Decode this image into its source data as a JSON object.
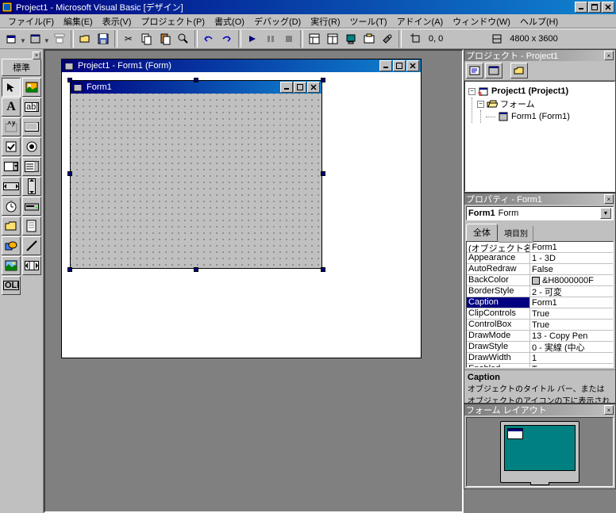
{
  "app": {
    "title": "Project1 - Microsoft Visual Basic [デザイン]"
  },
  "menu": {
    "file": "ファイル(F)",
    "edit": "編集(E)",
    "view": "表示(V)",
    "project": "プロジェクト(P)",
    "format": "書式(O)",
    "debug": "デバッグ(D)",
    "run": "実行(R)",
    "tools": "ツール(T)",
    "addins": "アドイン(A)",
    "window": "ウィンドウ(W)",
    "help": "ヘルプ(H)"
  },
  "toolbar": {
    "coords": "0, 0",
    "size": "4800 x 3600"
  },
  "toolbox": {
    "title": "標準"
  },
  "designer": {
    "title": "Project1 - Form1 (Form)",
    "form_title": "Form1"
  },
  "project_panel": {
    "title": "プロジェクト - Project1",
    "root": "Project1 (Project1)",
    "folder": "フォーム",
    "form": "Form1 (Form1)"
  },
  "properties_panel": {
    "title": "プロパティ - Form1",
    "combo_name": "Form1",
    "combo_type": "Form",
    "tab_alpha": "全体",
    "tab_category": "項目別",
    "rows": [
      {
        "k": "(オブジェクト名)",
        "v": "Form1"
      },
      {
        "k": "Appearance",
        "v": "1 - 3D"
      },
      {
        "k": "AutoRedraw",
        "v": "False"
      },
      {
        "k": "BackColor",
        "v": "&H8000000F",
        "swatch": true
      },
      {
        "k": "BorderStyle",
        "v": "2 - 可変"
      },
      {
        "k": "Caption",
        "v": "Form1",
        "selected": true
      },
      {
        "k": "ClipControls",
        "v": "True"
      },
      {
        "k": "ControlBox",
        "v": "True"
      },
      {
        "k": "DrawMode",
        "v": "13 - Copy Pen"
      },
      {
        "k": "DrawStyle",
        "v": "0 - 実線 (中心"
      },
      {
        "k": "DrawWidth",
        "v": "1"
      },
      {
        "k": "Enabled",
        "v": "True"
      }
    ],
    "help_title": "Caption",
    "help_text": "オブジェクトのタイトル バー、またはオブジェクトのアイコンの下に表示される文"
  },
  "formlayout_panel": {
    "title": "フォーム レイアウト"
  }
}
